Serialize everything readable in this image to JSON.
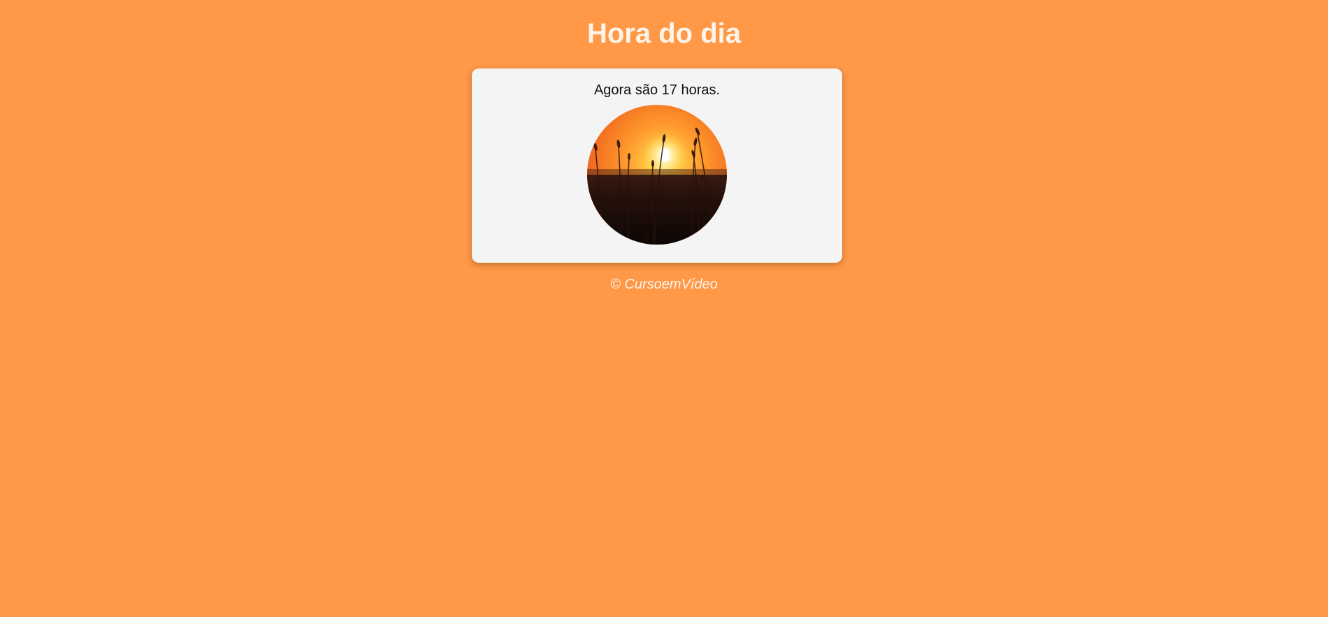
{
  "header": {
    "title": "Hora do dia"
  },
  "main": {
    "message": "Agora são 17 horas.",
    "image": {
      "subject": "sunset-over-field",
      "shape": "circle"
    }
  },
  "footer": {
    "text": "© CursoemVídeo"
  },
  "colors": {
    "background": "#ff9847",
    "card": "#f4f4f4",
    "title_text": "#fff4ea"
  }
}
